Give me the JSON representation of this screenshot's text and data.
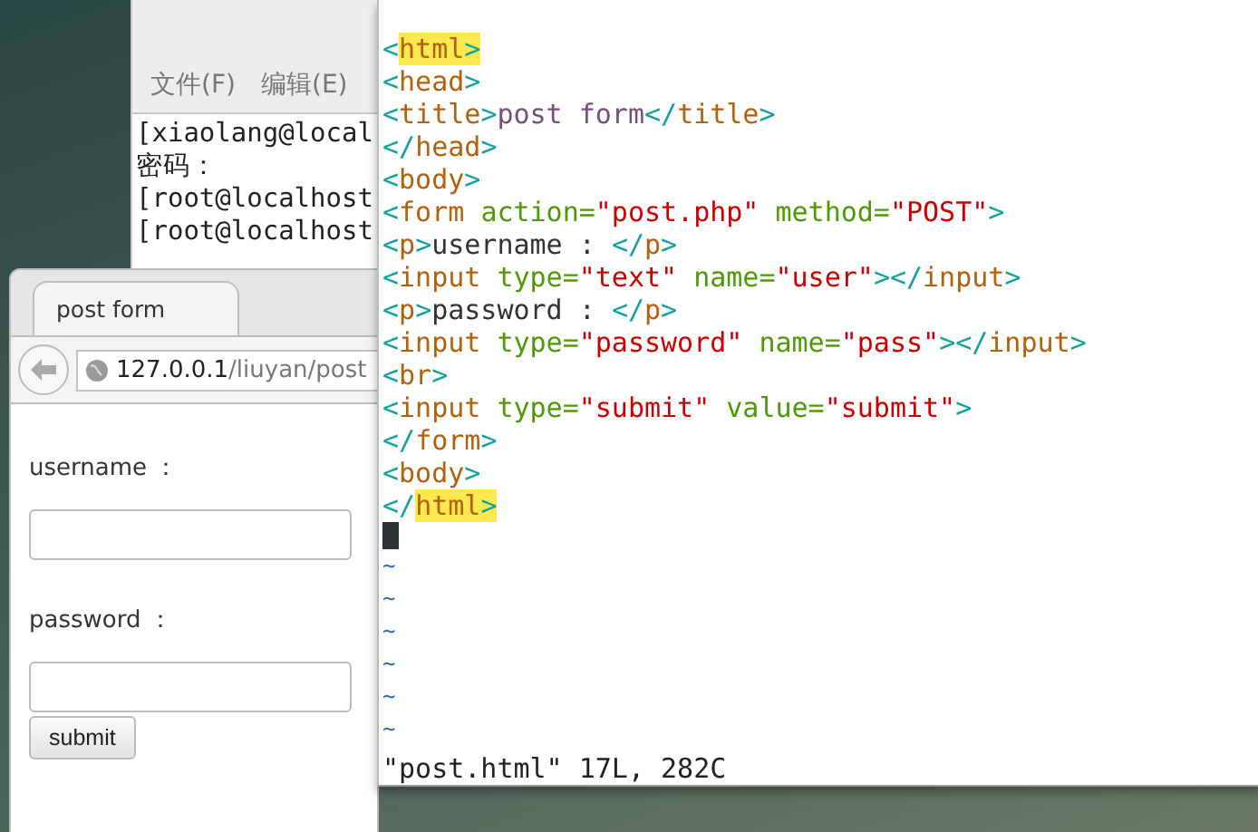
{
  "terminal": {
    "menu": [
      "文件(F)",
      "编辑(E)"
    ],
    "lines": [
      "[xiaolang@local",
      "密码：",
      "[root@localhost",
      "[root@localhost"
    ]
  },
  "browser": {
    "tab": {
      "title": "post form"
    },
    "url": {
      "host": "127.0.0.1",
      "path": "/liuyan/post"
    },
    "form": {
      "fields": [
        {
          "label": "username ："
        },
        {
          "label": "password ："
        }
      ],
      "submit": "submit"
    }
  },
  "editor": {
    "lines": [
      [
        {
          "kind": "punct",
          "text": "<"
        },
        {
          "kind": "match_tag",
          "text": "html"
        },
        {
          "kind": "match_punct",
          "text": ">"
        }
      ],
      [
        {
          "kind": "punct",
          "text": "<"
        },
        {
          "kind": "tag",
          "text": "head"
        },
        {
          "kind": "punct",
          "text": ">"
        }
      ],
      [
        {
          "kind": "punct",
          "text": "<"
        },
        {
          "kind": "tag",
          "text": "title"
        },
        {
          "kind": "punct",
          "text": ">"
        },
        {
          "kind": "title",
          "text": "post form"
        },
        {
          "kind": "punct",
          "text": "</"
        },
        {
          "kind": "tag",
          "text": "title"
        },
        {
          "kind": "punct",
          "text": ">"
        }
      ],
      [
        {
          "kind": "punct",
          "text": "</"
        },
        {
          "kind": "tag",
          "text": "head"
        },
        {
          "kind": "punct",
          "text": ">"
        }
      ],
      [
        {
          "kind": "punct",
          "text": "<"
        },
        {
          "kind": "tag",
          "text": "body"
        },
        {
          "kind": "punct",
          "text": ">"
        }
      ],
      [
        {
          "kind": "punct",
          "text": "<"
        },
        {
          "kind": "tag",
          "text": "form "
        },
        {
          "kind": "attr",
          "text": "action="
        },
        {
          "kind": "string",
          "text": "\"post.php\" "
        },
        {
          "kind": "attr",
          "text": "method="
        },
        {
          "kind": "string",
          "text": "\"POST\""
        },
        {
          "kind": "punct",
          "text": ">"
        }
      ],
      [
        {
          "kind": "punct",
          "text": "<"
        },
        {
          "kind": "tag",
          "text": "p"
        },
        {
          "kind": "punct",
          "text": ">"
        },
        {
          "kind": "text",
          "text": "username : "
        },
        {
          "kind": "punct",
          "text": "</"
        },
        {
          "kind": "tag",
          "text": "p"
        },
        {
          "kind": "punct",
          "text": ">"
        }
      ],
      [
        {
          "kind": "punct",
          "text": "<"
        },
        {
          "kind": "tag",
          "text": "input "
        },
        {
          "kind": "attr",
          "text": "type="
        },
        {
          "kind": "string",
          "text": "\"text\" "
        },
        {
          "kind": "attr",
          "text": "name="
        },
        {
          "kind": "string",
          "text": "\"user\""
        },
        {
          "kind": "punct",
          "text": "></"
        },
        {
          "kind": "tag",
          "text": "input"
        },
        {
          "kind": "punct",
          "text": ">"
        }
      ],
      [
        {
          "kind": "punct",
          "text": "<"
        },
        {
          "kind": "tag",
          "text": "p"
        },
        {
          "kind": "punct",
          "text": ">"
        },
        {
          "kind": "text",
          "text": "password : "
        },
        {
          "kind": "punct",
          "text": "</"
        },
        {
          "kind": "tag",
          "text": "p"
        },
        {
          "kind": "punct",
          "text": ">"
        }
      ],
      [
        {
          "kind": "punct",
          "text": "<"
        },
        {
          "kind": "tag",
          "text": "input "
        },
        {
          "kind": "attr",
          "text": "type="
        },
        {
          "kind": "string",
          "text": "\"password\" "
        },
        {
          "kind": "attr",
          "text": "name="
        },
        {
          "kind": "string",
          "text": "\"pass\""
        },
        {
          "kind": "punct",
          "text": "></"
        },
        {
          "kind": "tag",
          "text": "input"
        },
        {
          "kind": "punct",
          "text": ">"
        }
      ],
      [
        {
          "kind": "punct",
          "text": "<"
        },
        {
          "kind": "tag",
          "text": "br"
        },
        {
          "kind": "punct",
          "text": ">"
        }
      ],
      [
        {
          "kind": "punct",
          "text": "<"
        },
        {
          "kind": "tag",
          "text": "input "
        },
        {
          "kind": "attr",
          "text": "type="
        },
        {
          "kind": "string",
          "text": "\"submit\" "
        },
        {
          "kind": "attr",
          "text": "value="
        },
        {
          "kind": "string",
          "text": "\"submit\""
        },
        {
          "kind": "punct",
          "text": ">"
        }
      ],
      [
        {
          "kind": "punct",
          "text": "</"
        },
        {
          "kind": "tag",
          "text": "form"
        },
        {
          "kind": "punct",
          "text": ">"
        }
      ],
      [
        {
          "kind": "punct",
          "text": "<"
        },
        {
          "kind": "tag",
          "text": "body"
        },
        {
          "kind": "punct",
          "text": ">"
        }
      ],
      [
        {
          "kind": "punct",
          "text": "</"
        },
        {
          "kind": "match_tag",
          "text": "html"
        },
        {
          "kind": "match_punct",
          "text": ">"
        }
      ]
    ],
    "tildes": [
      "~",
      "~",
      "~",
      "~",
      "~",
      "~"
    ],
    "status": "\"post.html\" 17L, 282C"
  }
}
